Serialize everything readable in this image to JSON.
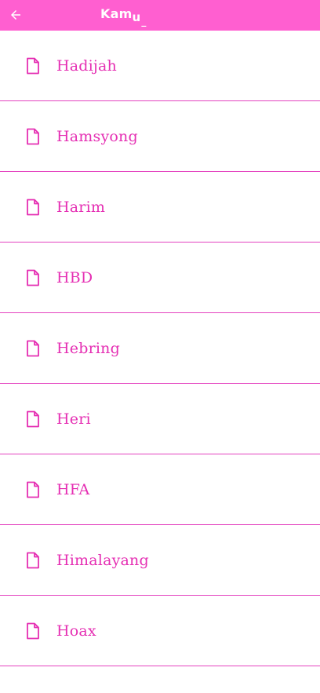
{
  "header": {
    "back_icon": "arrow-left-icon",
    "title_main": "Kam",
    "title_sub": "u",
    "title_tail": "_"
  },
  "colors": {
    "accent": "#ff5fd0",
    "text": "#e52fb3",
    "divider": "#e444c0"
  },
  "list": {
    "item_icon": "file-icon",
    "items": [
      {
        "label": "Hadijah"
      },
      {
        "label": "Hamsyong"
      },
      {
        "label": "Harim"
      },
      {
        "label": "HBD"
      },
      {
        "label": "Hebring"
      },
      {
        "label": "Heri"
      },
      {
        "label": "HFA"
      },
      {
        "label": "Himalayang"
      },
      {
        "label": "Hoax"
      }
    ]
  }
}
